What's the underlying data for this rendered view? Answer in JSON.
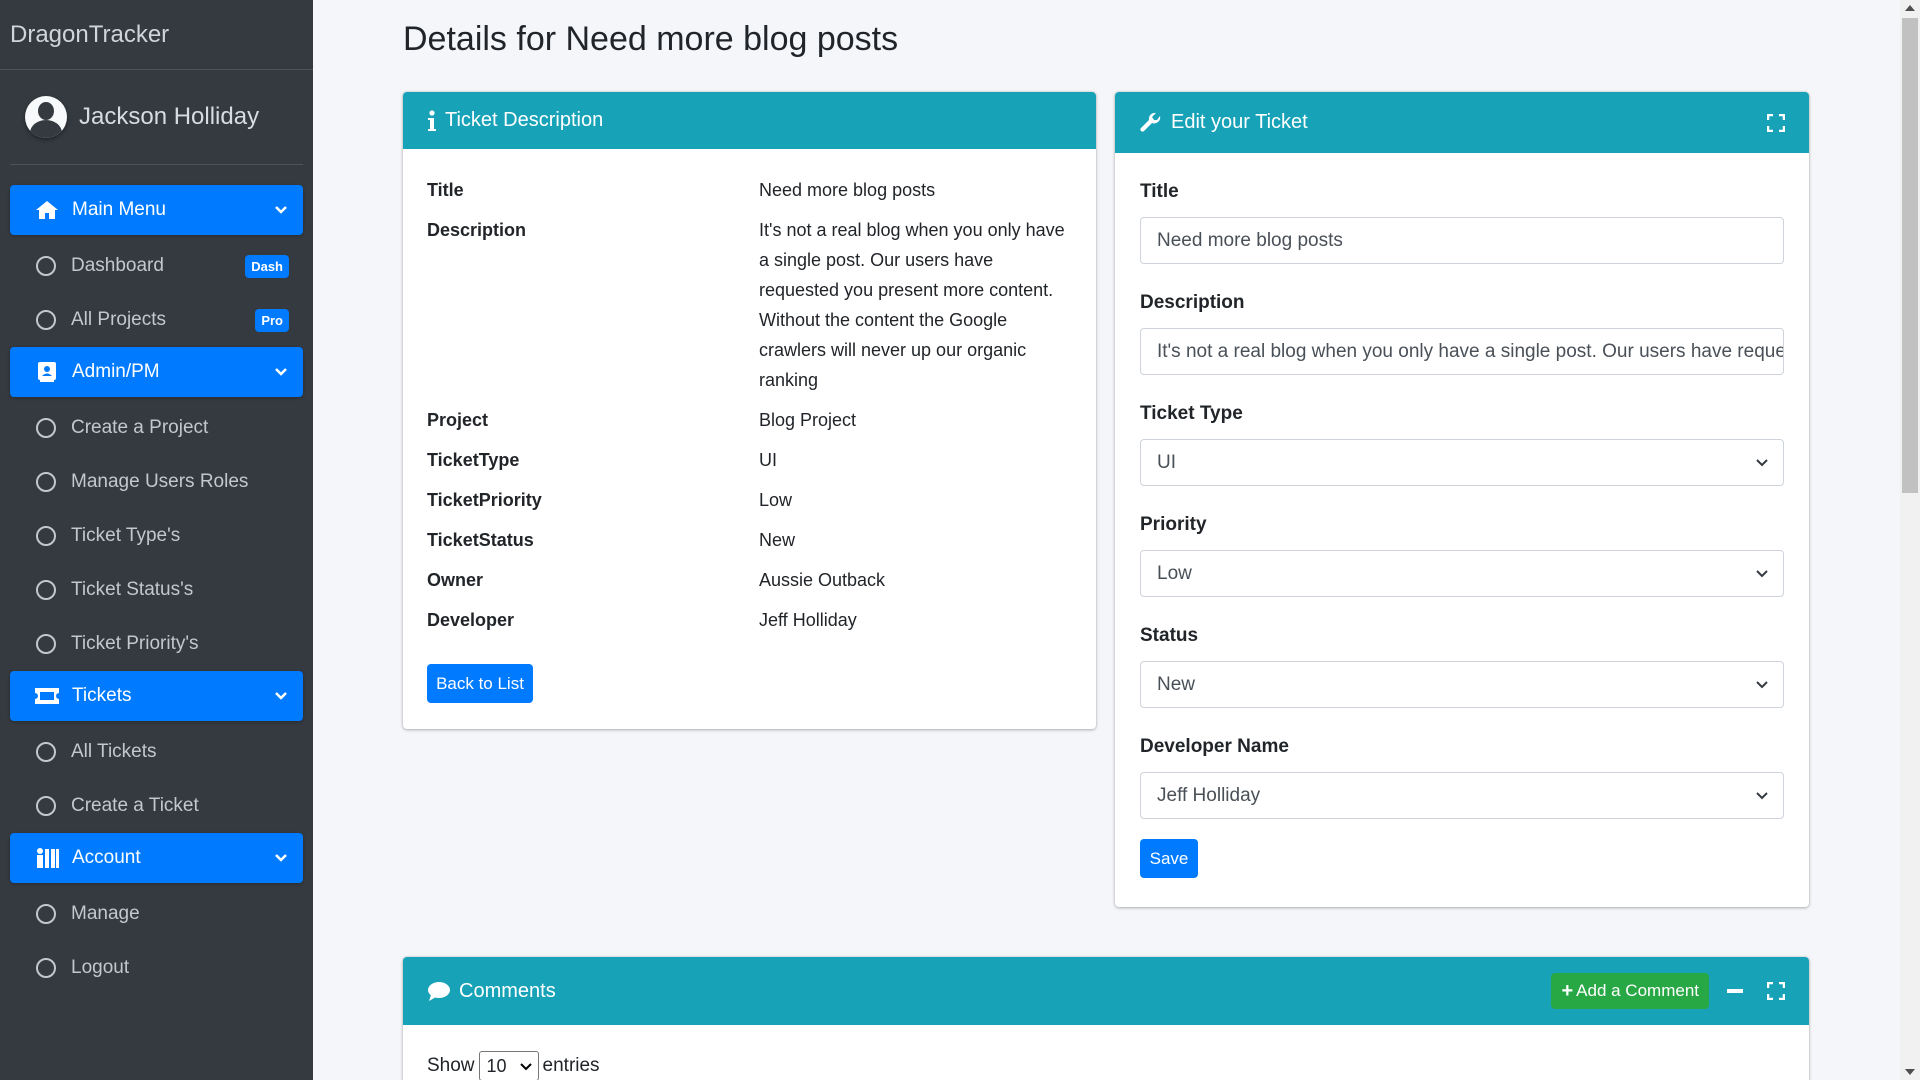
{
  "brand": "DragonTracker",
  "user": {
    "name": "Jackson Holliday"
  },
  "nav": {
    "main_menu": {
      "label": "Main Menu",
      "items": [
        {
          "label": "Dashboard",
          "badge": "Dash"
        },
        {
          "label": "All Projects",
          "badge": "Pro"
        }
      ]
    },
    "admin": {
      "label": "Admin/PM",
      "items": [
        {
          "label": "Create a Project"
        },
        {
          "label": "Manage Users Roles"
        },
        {
          "label": "Ticket Type's"
        },
        {
          "label": "Ticket Status's"
        },
        {
          "label": "Ticket Priority's"
        }
      ]
    },
    "tickets": {
      "label": "Tickets",
      "items": [
        {
          "label": "All Tickets"
        },
        {
          "label": "Create a Ticket"
        }
      ]
    },
    "account": {
      "label": "Account",
      "items": [
        {
          "label": "Manage"
        },
        {
          "label": "Logout"
        }
      ]
    }
  },
  "page_title": "Details for Need more blog posts",
  "description_card": {
    "title": "Ticket Description",
    "fields": [
      {
        "label": "Title",
        "value": "Need more blog posts"
      },
      {
        "label": "Description",
        "value": "It's not a real blog when you only have a single post. Our users have requested you present more content. Without the content the Google crawlers will never up our organic ranking"
      },
      {
        "label": "Project",
        "value": "Blog Project"
      },
      {
        "label": "TicketType",
        "value": "UI"
      },
      {
        "label": "TicketPriority",
        "value": "Low"
      },
      {
        "label": "TicketStatus",
        "value": "New"
      },
      {
        "label": "Owner",
        "value": "Aussie Outback"
      },
      {
        "label": "Developer",
        "value": "Jeff Holliday"
      }
    ],
    "back_button": "Back to List"
  },
  "edit_card": {
    "title": "Edit your Ticket",
    "title_label": "Title",
    "title_value": "Need more blog posts",
    "description_label": "Description",
    "description_value": "It's not a real blog when you only have a single post. Our users have reque",
    "ticket_type_label": "Ticket Type",
    "ticket_type_value": "UI",
    "priority_label": "Priority",
    "priority_value": "Low",
    "status_label": "Status",
    "status_value": "New",
    "developer_label": "Developer Name",
    "developer_value": "Jeff Holliday",
    "save_button": "Save"
  },
  "comments_card": {
    "title": "Comments",
    "add_button": "Add a Comment",
    "show_label": "Show",
    "entries_value": "10",
    "entries_label": "entries"
  },
  "colors": {
    "sidebar": "#343a40",
    "primary": "#007bff",
    "card_header": "#17a2b8",
    "success": "#28a745"
  }
}
